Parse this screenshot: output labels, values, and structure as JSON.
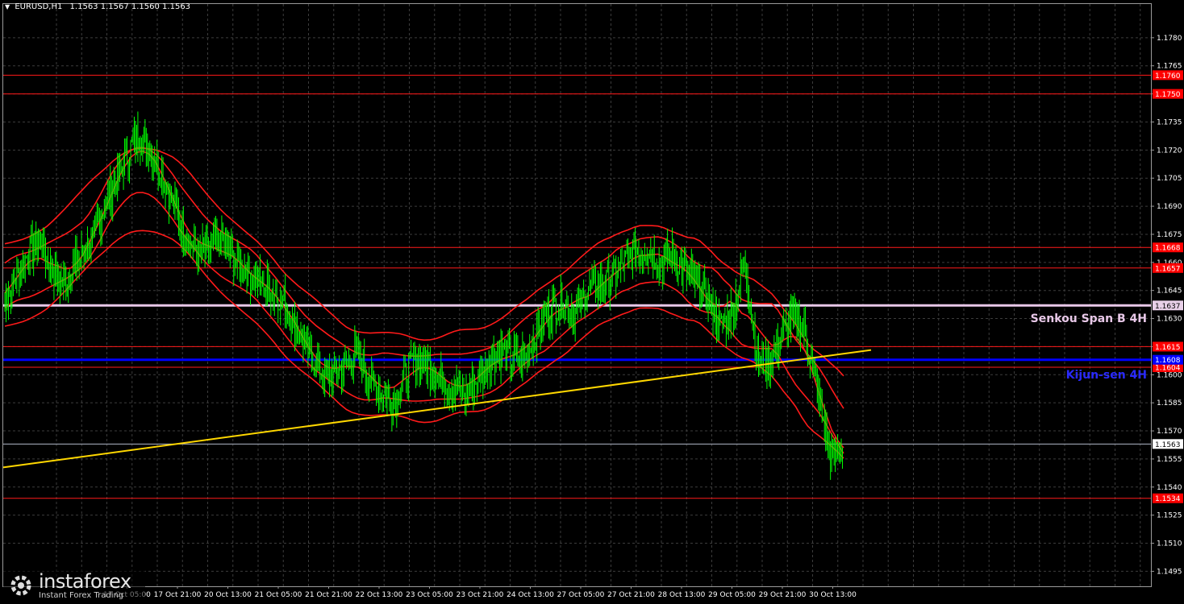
{
  "header": {
    "symbol": "EURUSD,H1",
    "ohlc": "1.1563 1.1567 1.1560 1.1563"
  },
  "watermark": {
    "brand": "instaforex",
    "tagline": "Instant Forex Trading"
  },
  "colors": {
    "background": "#000000",
    "grid": "#3c3c3c",
    "candles": "#00ff00",
    "ichimoku": "#ff1a1a",
    "kijun": "#0000ff",
    "senkou": "#e8c8e8",
    "trendline": "#ffd700",
    "level": "#ff1a1a",
    "price_line": "#b0b8c8"
  },
  "chart_data": {
    "type": "line",
    "title": "EURUSD,H1",
    "ylim": [
      1.1487,
      1.1798
    ],
    "y_ticks": [
      "1.1780",
      "1.1765",
      "1.1750",
      "1.1735",
      "1.1720",
      "1.1705",
      "1.1690",
      "1.1675",
      "1.1660",
      "1.1645",
      "1.1630",
      "1.1615",
      "1.1600",
      "1.1585",
      "1.1570",
      "1.1555",
      "1.1540",
      "1.1525",
      "1.1510",
      "1.1495"
    ],
    "x_ticks": [
      "17 Oct 05:00",
      "17 Oct 21:00",
      "20 Oct 13:00",
      "21 Oct 05:00",
      "21 Oct 21:00",
      "22 Oct 13:00",
      "23 Oct 05:00",
      "23 Oct 21:00",
      "24 Oct 13:00",
      "27 Oct 05:00",
      "27 Oct 21:00",
      "28 Oct 13:00",
      "29 Oct 05:00",
      "29 Oct 21:00",
      "30 Oct 13:00"
    ],
    "series": [
      {
        "values": [
          1.1638,
          1.1652,
          1.1664,
          1.1672,
          1.1655,
          1.1648,
          1.166,
          1.1668,
          1.1685,
          1.17,
          1.1715,
          1.1728,
          1.1722,
          1.1708,
          1.169,
          1.1675,
          1.1665,
          1.1668,
          1.1672,
          1.166,
          1.1655,
          1.165,
          1.1645,
          1.164,
          1.1625,
          1.1615,
          1.1602,
          1.1598,
          1.1605,
          1.1612,
          1.16,
          1.159,
          1.1585,
          1.16,
          1.161,
          1.1605,
          1.1598,
          1.1592,
          1.159,
          1.1598,
          1.1608,
          1.1612,
          1.1608,
          1.161,
          1.1625,
          1.1635,
          1.164,
          1.1632,
          1.1645,
          1.1648,
          1.165,
          1.166,
          1.1665,
          1.1668,
          1.166,
          1.1665,
          1.1655,
          1.165,
          1.164,
          1.1625,
          1.1635,
          1.166,
          1.1608,
          1.1605,
          1.162,
          1.1632,
          1.162,
          1.159,
          1.1555,
          1.156
        ]
      },
      {
        "name": "Kijun-sen 4H",
        "values": [
          1.1608
        ]
      },
      {
        "name": "Senkou Span B 4H",
        "values": [
          1.1637
        ]
      }
    ],
    "levels": [
      {
        "label": "1.1760",
        "value": 1.176
      },
      {
        "label": "1.1750",
        "value": 1.175
      },
      {
        "label": "1.1668",
        "value": 1.1668
      },
      {
        "label": "1.1657",
        "value": 1.1657
      },
      {
        "label": "1.1615",
        "value": 1.1615
      },
      {
        "label": "1.1604",
        "value": 1.1604
      },
      {
        "label": "1.1534",
        "value": 1.1534
      }
    ],
    "lines": [
      {
        "label": "1.1637",
        "name": "Senkou Span B 4H",
        "value": 1.1637
      },
      {
        "label": "1.1608",
        "name": "Kijun-sen 4H",
        "value": 1.1608
      },
      {
        "label": "1.1563",
        "name": "current price",
        "value": 1.1563
      }
    ],
    "annotations": {
      "senkou": "Senkou Span B 4H",
      "kijun": "Kijun-sen 4H"
    }
  }
}
